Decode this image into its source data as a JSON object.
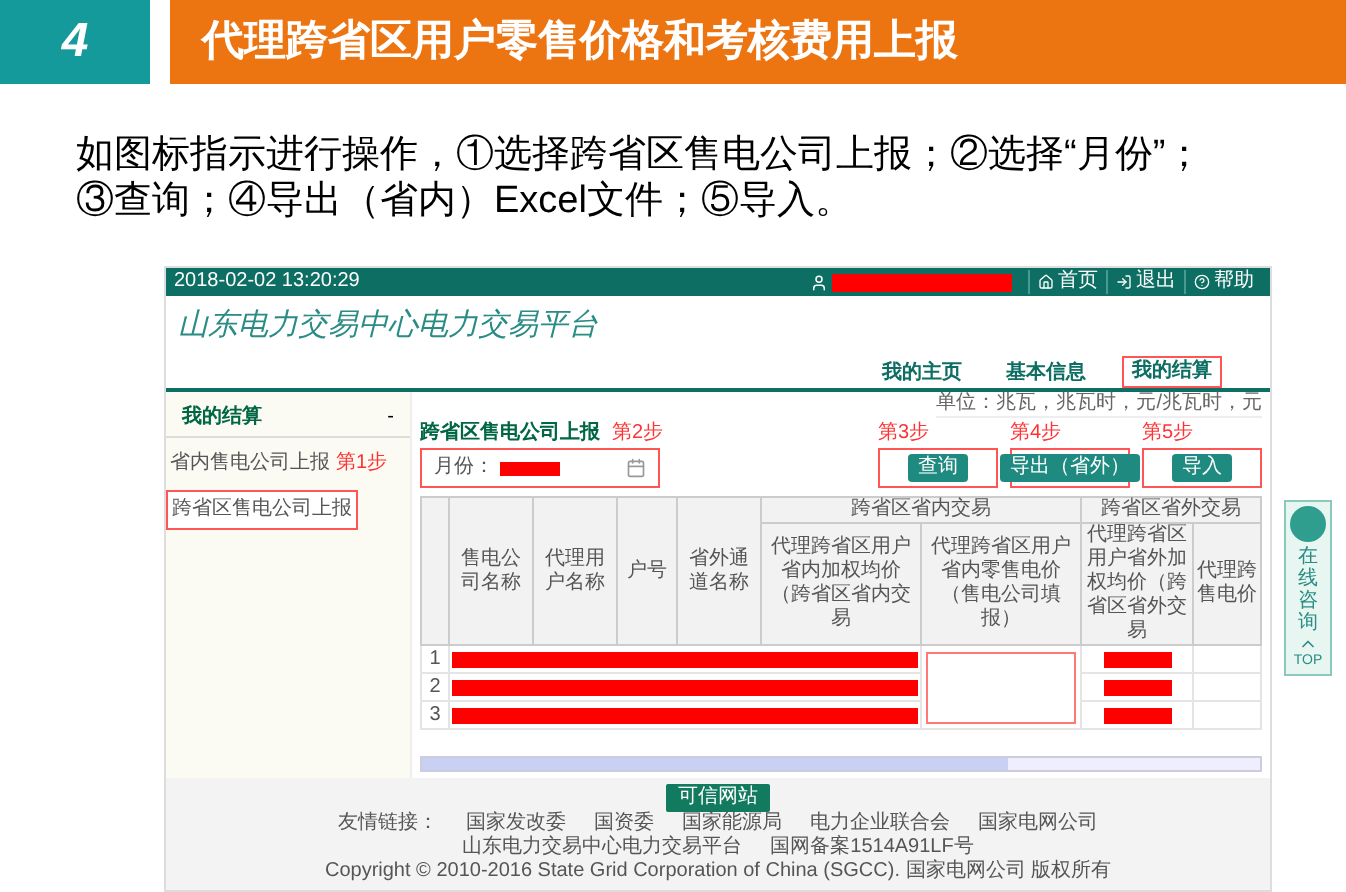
{
  "slide": {
    "number": "4",
    "title": "代理跨省区用户零售价格和考核费用上报",
    "instruction": "如图标指示进行操作，①选择跨省区售电公司上报；②选择“月份”；③查询；④导出（省内）Excel文件；⑤导入。"
  },
  "screenshot": {
    "timestamp": "2018-02-02 13:20:29",
    "top_links": [
      {
        "kind": "home",
        "label": "首页"
      },
      {
        "kind": "logout",
        "label": "退出"
      },
      {
        "kind": "help",
        "label": "帮助"
      }
    ],
    "platform_title": "山东电力交易中心电力交易平台",
    "nav": [
      {
        "label": "我的主页",
        "selected": false
      },
      {
        "label": "基本信息",
        "selected": false
      },
      {
        "label": "我的结算",
        "selected": true
      }
    ],
    "units": "单位：兆瓦，兆瓦时，元/兆瓦时，元",
    "sidebar": {
      "heading": "我的结算",
      "toggle": "-",
      "items": [
        {
          "label": "省内售电公司上报",
          "selected": false,
          "step": "第1步"
        },
        {
          "label": "跨省区售电公司上报",
          "selected": true
        }
      ]
    },
    "panel": {
      "title": "跨省区售电公司上报",
      "title_step": "第2步",
      "month_label": "月份：",
      "buttons": [
        {
          "label": "查询",
          "step": "第3步"
        },
        {
          "label": "导出（省外）",
          "step": "第4步"
        },
        {
          "label": "导入",
          "step": "第5步"
        }
      ]
    },
    "table": {
      "columns": [
        "售电公司名称",
        "代理用户名称",
        "户号",
        "省外通道名称"
      ],
      "groups": [
        {
          "label": "跨省区省内交易",
          "columns": [
            "代理跨省区用户省内加权均价（跨省区省内交易",
            "代理跨省区用户省内零售电价（售电公司填报）"
          ]
        },
        {
          "label": "跨省区省外交易",
          "columns": [
            "代理跨省区用户省外加权均价（跨省区省外交易",
            "代理跨售电价"
          ]
        }
      ],
      "rows": [
        "1",
        "2",
        "3"
      ]
    },
    "footer": {
      "badge": "可信网站",
      "links_label": "友情链接：",
      "links": [
        "国家发改委",
        "国资委",
        "国家能源局",
        "电力企业联合会",
        "国家电网公司"
      ],
      "line2": [
        "山东电力交易中心电力交易平台",
        "国网备案1514A91LF号"
      ],
      "copyright": "Copyright © 2010-2016 State Grid Corporation of China (SGCC). 国家电网公司 版权所有"
    }
  },
  "widget": {
    "label": "在线咨询",
    "top": "TOP"
  }
}
